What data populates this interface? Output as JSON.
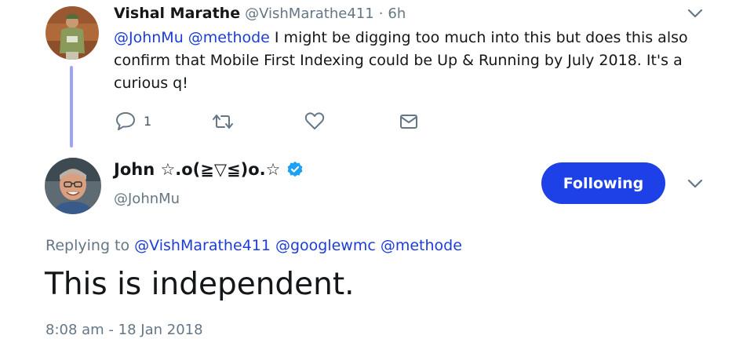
{
  "parent_tweet": {
    "author_name": "Vishal Marathe",
    "author_handle": "@VishMarathe411",
    "separator": "·",
    "time_ago": "6h",
    "mention_1": "@JohnMu",
    "mention_2": "@methode",
    "body_1": " I might be digging too much into this but does this also",
    "body_2": "confirm that Mobile First Indexing could be Up & Running by July 2018. It's a",
    "body_3": "curious q!",
    "reply_count": "1",
    "icons": [
      "reply-icon",
      "retweet-icon",
      "like-icon",
      "message-icon",
      "chevron-down-icon"
    ]
  },
  "main_tweet": {
    "author_name": "John ☆.o(≧▽≦)o.☆",
    "author_handle": "@JohnMu",
    "follow_label": "Following",
    "replying_label": "Replying to",
    "replying_mentions": [
      "@VishMarathe411",
      "@googlewmc",
      "@methode"
    ],
    "text": "This is independent.",
    "timestamp": "8:08 am - 18 Jan 2018",
    "icons": [
      "verified-badge-icon",
      "chevron-down-icon"
    ]
  },
  "colors": {
    "accent": "#1d41e6",
    "mention": "#1c3dd8",
    "muted": "#657786",
    "thread_line": "#9fa3f5",
    "verified": "#1da1f2"
  }
}
